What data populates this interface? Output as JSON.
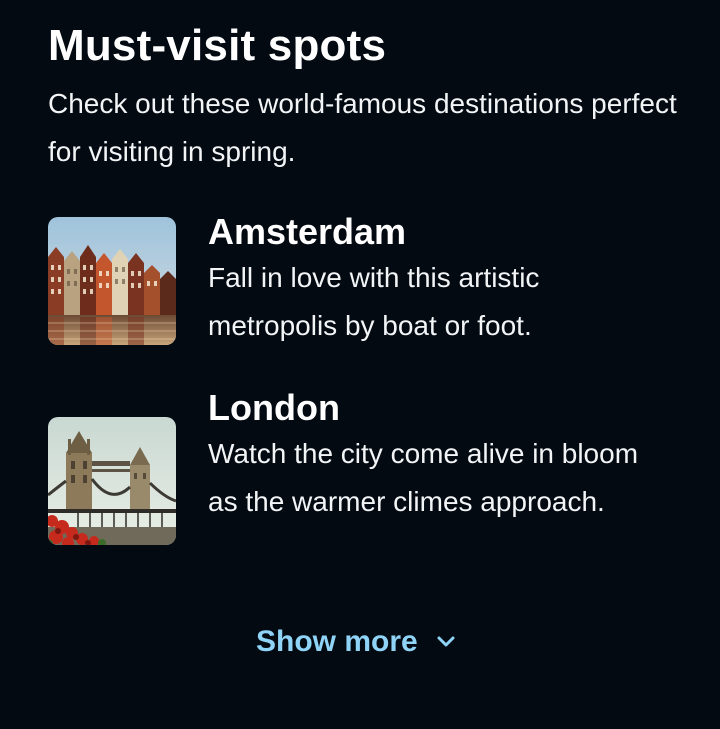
{
  "section": {
    "title": "Must-visit spots",
    "subtitle": "Check out these world-famous destinations perfect for visiting in spring."
  },
  "destinations": [
    {
      "name": "Amsterdam",
      "description": "Fall in love with this artistic metropolis by boat or foot.",
      "image_icon": "amsterdam-canal-houses-image"
    },
    {
      "name": "London",
      "description": "Watch the city come alive in bloom as the warmer climes approach.",
      "image_icon": "tower-bridge-image"
    }
  ],
  "show_more": {
    "label": "Show more",
    "icon": "chevron-down-icon"
  },
  "colors": {
    "background": "#030a12",
    "text": "#ffffff",
    "accent": "#8fd3f6"
  }
}
